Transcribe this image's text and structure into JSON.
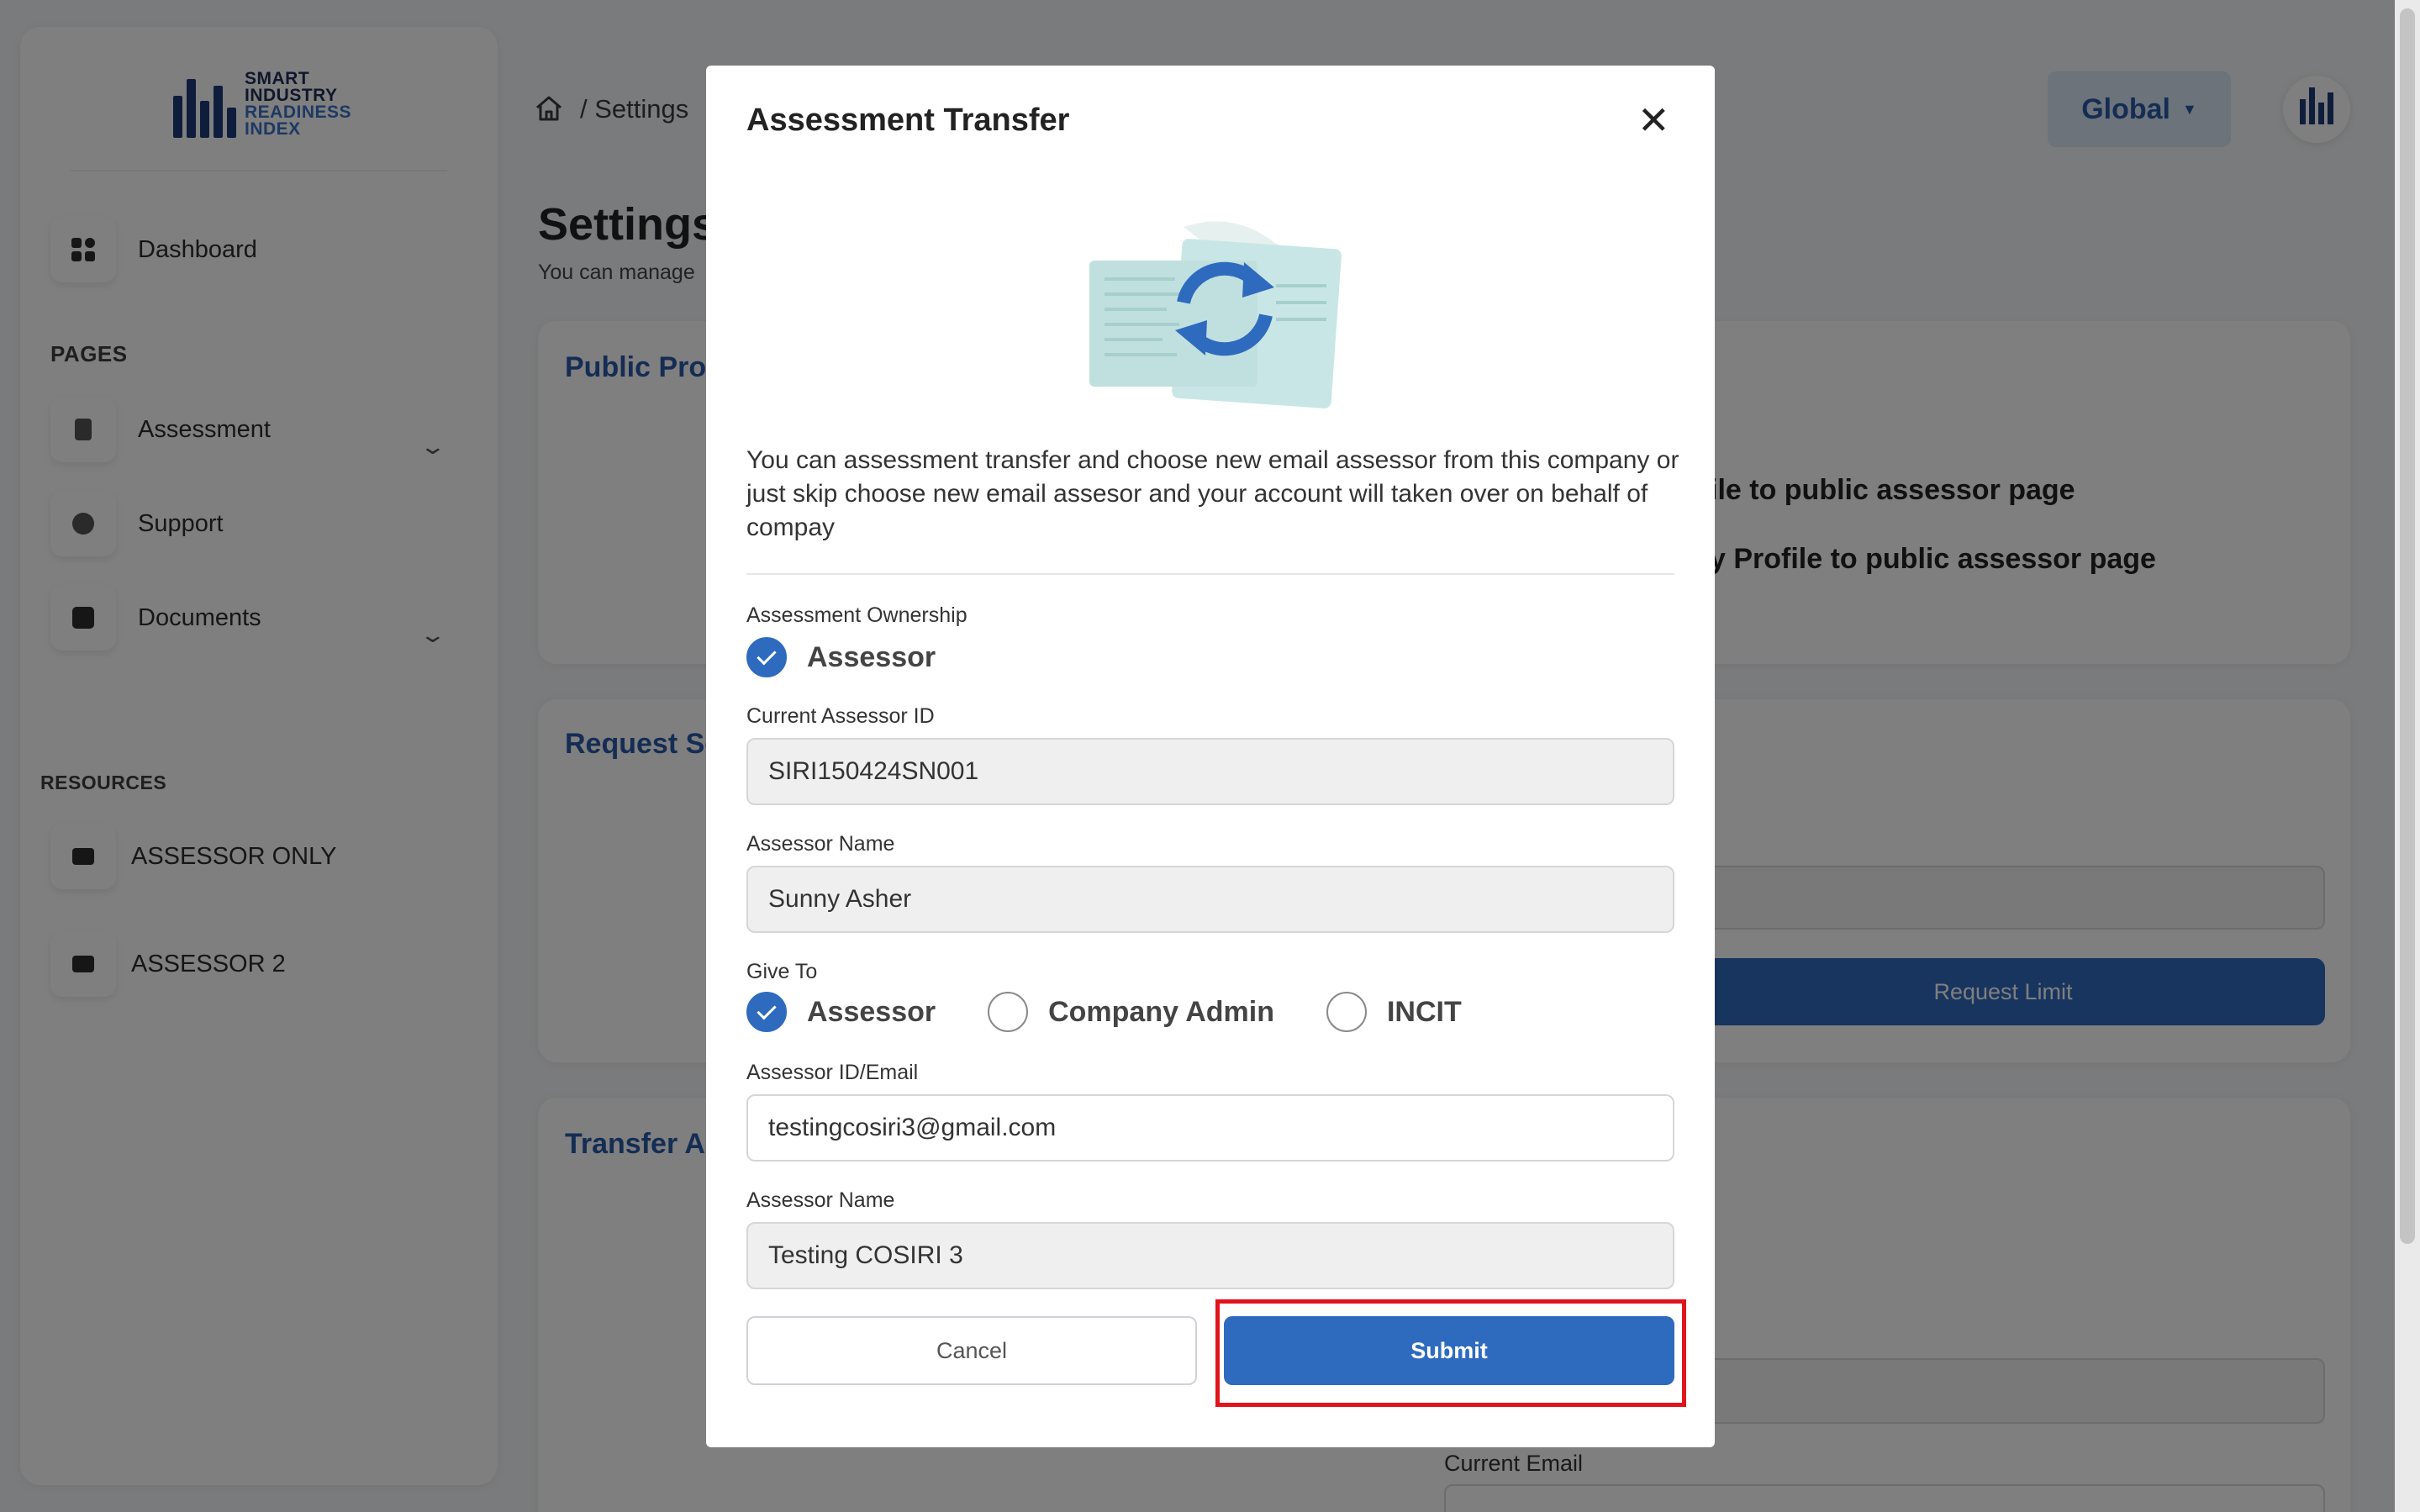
{
  "brand": {
    "logo_line1": "SMART",
    "logo_line2": "INDUSTRY",
    "logo_line3": "READINESS",
    "logo_line4": "INDEX"
  },
  "sidebar": {
    "dashboard_label": "Dashboard",
    "pages_heading": "PAGES",
    "items": [
      {
        "label": "Assessment",
        "icon": "assessment-icon",
        "has_chevron": true
      },
      {
        "label": "Support",
        "icon": "support-icon",
        "has_chevron": false
      },
      {
        "label": "Documents",
        "icon": "documents-icon",
        "has_chevron": true
      }
    ],
    "resources_heading": "RESOURCES",
    "resources": [
      {
        "label": "ASSESSOR ONLY",
        "icon": "folder-icon"
      },
      {
        "label": "ASSESSOR 2",
        "icon": "folder-icon"
      }
    ]
  },
  "header": {
    "breadcrumb": "/ Settings",
    "region_button": "Global",
    "page_title": "Settings",
    "page_subtitle": "You can manage"
  },
  "background": {
    "card1_title": "Public Prof",
    "card1_line1": "ile to public assessor page",
    "card1_line2": "y Profile to public assessor page",
    "card2_title": "Request Se",
    "request_limit_button": "Request Limit",
    "card3_title": "Transfer As",
    "current_email_label": "Current Email"
  },
  "modal": {
    "title": "Assessment Transfer",
    "description": "You can assessment transfer and choose new email assessor from this company or just skip choose new email assesor and your account will taken over on behalf of compay",
    "ownership_label": "Assessment Ownership",
    "ownership_option": "Assessor",
    "current_id_label": "Current Assessor ID",
    "current_id_value": "SIRI150424SN001",
    "assessor_name_label": "Assessor Name",
    "assessor_name_value": "Sunny Asher",
    "give_to_label": "Give To",
    "give_to_options": [
      {
        "label": "Assessor",
        "checked": true
      },
      {
        "label": "Company Admin",
        "checked": false
      },
      {
        "label": "INCIT",
        "checked": false
      }
    ],
    "new_id_label": "Assessor ID/Email",
    "new_id_value": "testingcosiri3@gmail.com",
    "new_name_label": "Assessor Name",
    "new_name_value": "Testing COSIRI 3",
    "cancel_label": "Cancel",
    "submit_label": "Submit"
  },
  "colors": {
    "primary": "#2e6bbf",
    "highlight": "#e0141c",
    "overlay": "rgba(0,0,0,0.5)"
  }
}
